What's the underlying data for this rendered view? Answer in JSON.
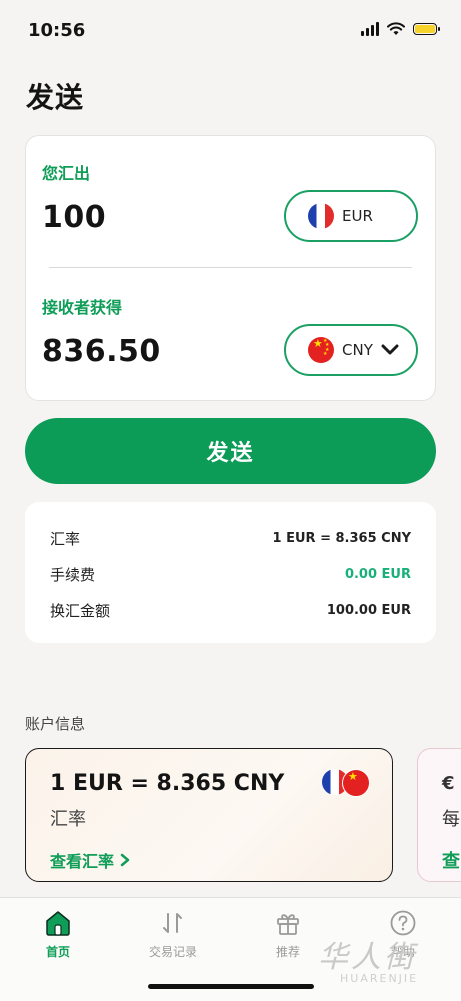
{
  "status": {
    "time": "10:56"
  },
  "page_title": "发送",
  "converter": {
    "send_label": "您汇出",
    "send_amount": "100",
    "send_currency": "EUR",
    "receive_label": "接收者获得",
    "receive_amount": "836.50",
    "receive_currency": "CNY"
  },
  "send_button": "发送",
  "summary": [
    {
      "label": "汇率",
      "value": "1 EUR = 8.365 CNY"
    },
    {
      "label": "手续费",
      "value": "0.00 EUR"
    },
    {
      "label": "换汇金额",
      "value": "100.00 EUR"
    }
  ],
  "account_section": "账户信息",
  "rate_card": {
    "rate": "1 EUR = 8.365 CNY",
    "label": "汇率",
    "link": "查看汇率"
  },
  "peek_card": {
    "line1": "€",
    "line2": "每",
    "line3": "查"
  },
  "tabs": [
    {
      "label": "首页",
      "icon": "home-icon",
      "active": true
    },
    {
      "label": "交易记录",
      "icon": "transactions-icon",
      "active": false
    },
    {
      "label": "推荐",
      "icon": "gift-icon",
      "active": false
    },
    {
      "label": "帮助",
      "icon": "help-icon",
      "active": false
    }
  ],
  "watermark": {
    "text": "华人街",
    "sub": "HUARENJIE"
  },
  "colors": {
    "accent": "#0c9c57",
    "fee": "#17b07a",
    "background": "#f5f4f2"
  }
}
